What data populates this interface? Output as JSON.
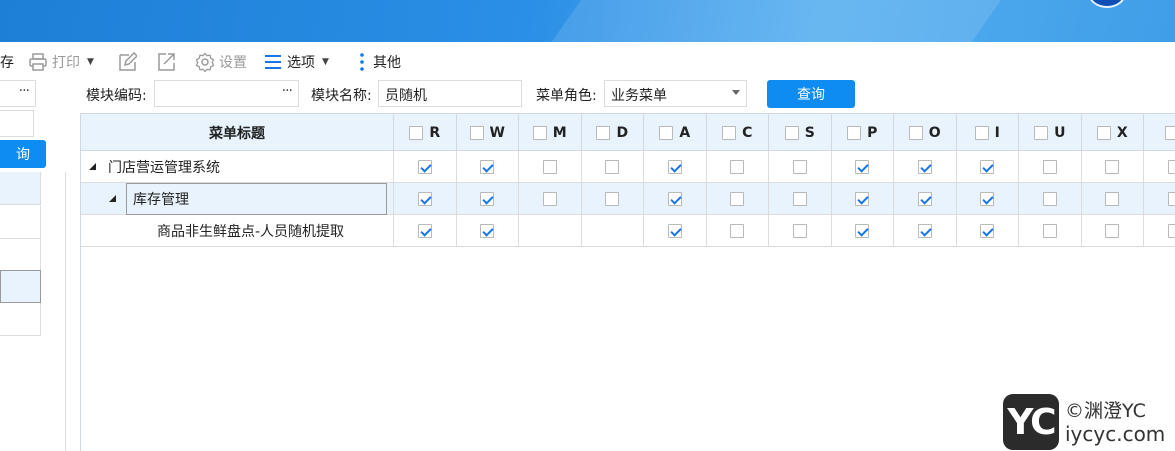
{
  "toolbar": {
    "save_partial": "存",
    "print_label": "打印",
    "settings_label": "设置",
    "options_label": "选项",
    "more_label": "其他"
  },
  "filters": {
    "left_partial_dots": "···",
    "module_code_label": "模块编码:",
    "module_code_value": "",
    "module_code_dots": "···",
    "module_name_label": "模块名称:",
    "module_name_value": "员随机",
    "menu_role_label": "菜单角色:",
    "menu_role_value": "业务菜单",
    "query_button": "查询"
  },
  "left_panel": {
    "button_partial": "询"
  },
  "grid": {
    "title_header": "菜单标题",
    "columns": [
      "R",
      "W",
      "M",
      "D",
      "A",
      "C",
      "S",
      "P",
      "O",
      "I",
      "U",
      "X",
      ""
    ],
    "rows": [
      {
        "label": "门店营运管理系统",
        "level": 0,
        "expanded": true,
        "checks": [
          true,
          true,
          false,
          false,
          true,
          false,
          false,
          true,
          true,
          true,
          false,
          false,
          false
        ]
      },
      {
        "label": "库存管理",
        "level": 1,
        "expanded": true,
        "checks": [
          true,
          true,
          false,
          false,
          true,
          false,
          false,
          true,
          true,
          true,
          false,
          false,
          false
        ]
      },
      {
        "label": "商品非生鲜盘点-人员随机提取",
        "level": 2,
        "expanded": false,
        "checks": [
          true,
          true,
          null,
          null,
          true,
          false,
          false,
          true,
          true,
          true,
          false,
          false,
          false
        ]
      }
    ]
  },
  "watermark": {
    "logo": "YC",
    "line1": "©渊澄YC",
    "line2": "iycyc.com"
  },
  "colors": {
    "accent": "#0e8cf1",
    "header_bg": "#e8f3fd",
    "check": "#1677e8"
  }
}
